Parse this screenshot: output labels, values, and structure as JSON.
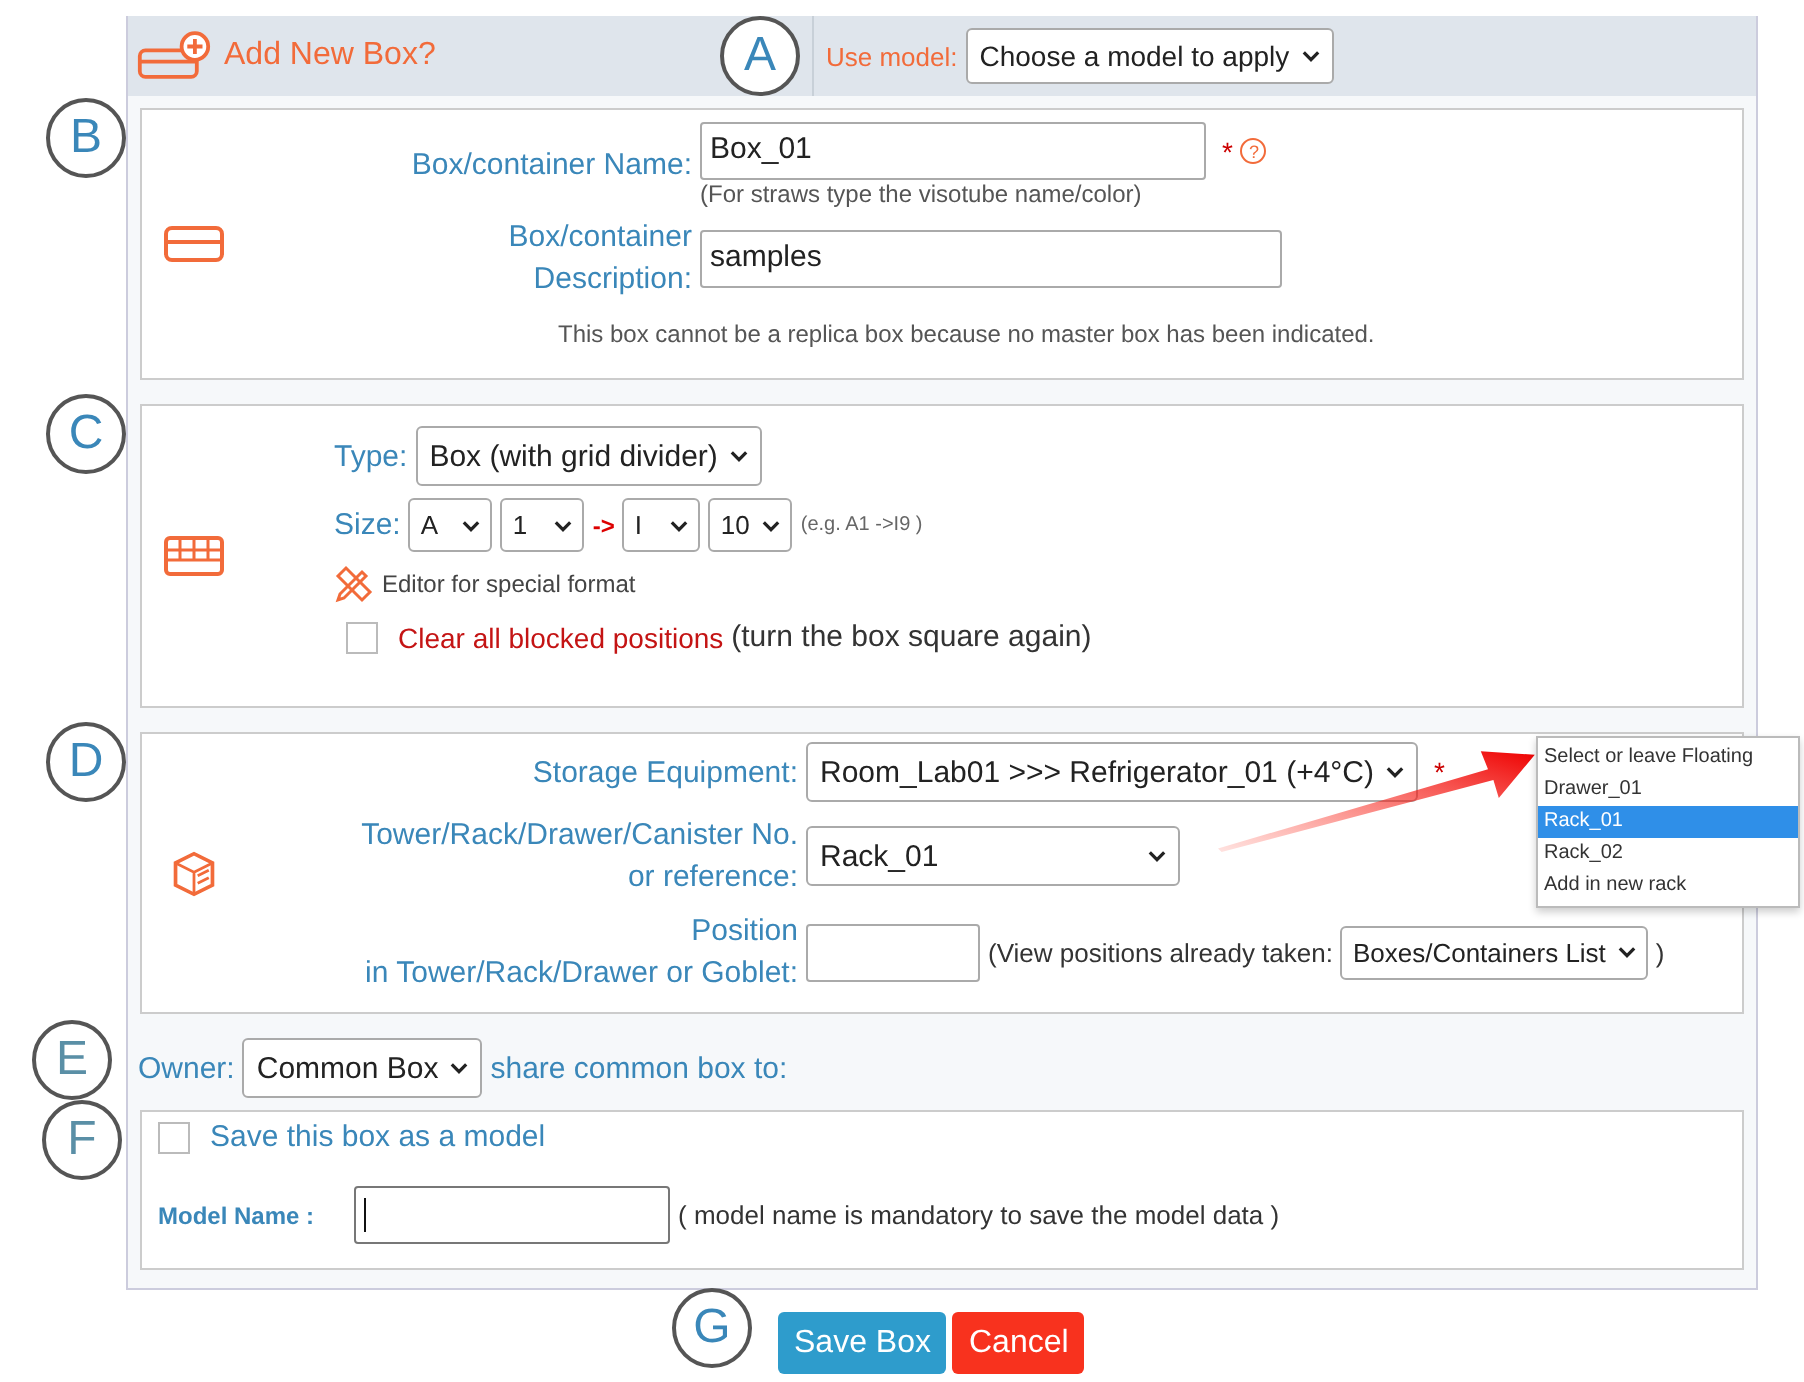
{
  "header": {
    "marker": "A",
    "title": "Add New Box?",
    "model_label": "Use model:",
    "model_select": "Choose a model to apply"
  },
  "name_section": {
    "marker": "B",
    "name_label": "Box/container Name:",
    "name_value": "Box_01",
    "required": "*",
    "help": "?",
    "name_hint": "(For straws type the visotube name/color)",
    "desc_label": "Box/container Description:",
    "desc_value": "samples",
    "note": "This box cannot be a replica box because no master box has been indicated."
  },
  "type_section": {
    "marker": "C",
    "type_label": "Type:",
    "type_value": "Box (with grid divider)",
    "size_label": "Size:",
    "size_from_row": "A",
    "size_from_col": "1",
    "arrow": "->",
    "size_to_row": "I",
    "size_to_col": "10",
    "size_example": "(e.g. A1 ->I9 )",
    "editor_link": "Editor for special format",
    "clear_checked": false,
    "clear_label": "Clear all blocked positions",
    "clear_note": "(turn the box square again)"
  },
  "storage_section": {
    "marker": "D",
    "equipment_label": "Storage Equipment:",
    "equipment_value": "Room_Lab01 >>> Refrigerator_01 (+4°C)",
    "required": "*",
    "rack_label": "Tower/Rack/Drawer/Canister No. or reference:",
    "rack_value": "Rack_01",
    "position_label": [
      "Position",
      "in Tower/Rack/Drawer or Goblet:"
    ],
    "position_note": "(View positions already taken:",
    "position_list": "Boxes/Containers List",
    "position_close": ")"
  },
  "rack_dropdown": {
    "options": [
      {
        "label": "Select or leave Floating",
        "selected": false
      },
      {
        "label": "Drawer_01",
        "selected": false
      },
      {
        "label": "Rack_01",
        "selected": true
      },
      {
        "label": "Rack_02",
        "selected": false
      },
      {
        "label": "Add in new rack",
        "selected": false
      }
    ]
  },
  "owner_row": {
    "marker": "E",
    "owner_label": "Owner:",
    "owner_value": "Common Box",
    "share_label": "share common box to:"
  },
  "model_section": {
    "marker": "F",
    "save_checked": false,
    "save_label": "Save this box as a model",
    "model_name_label": "Model Name :",
    "model_name_note": "( model name is mandatory to save the model data )"
  },
  "actions": {
    "marker": "G",
    "save": "Save Box",
    "cancel": "Cancel"
  }
}
